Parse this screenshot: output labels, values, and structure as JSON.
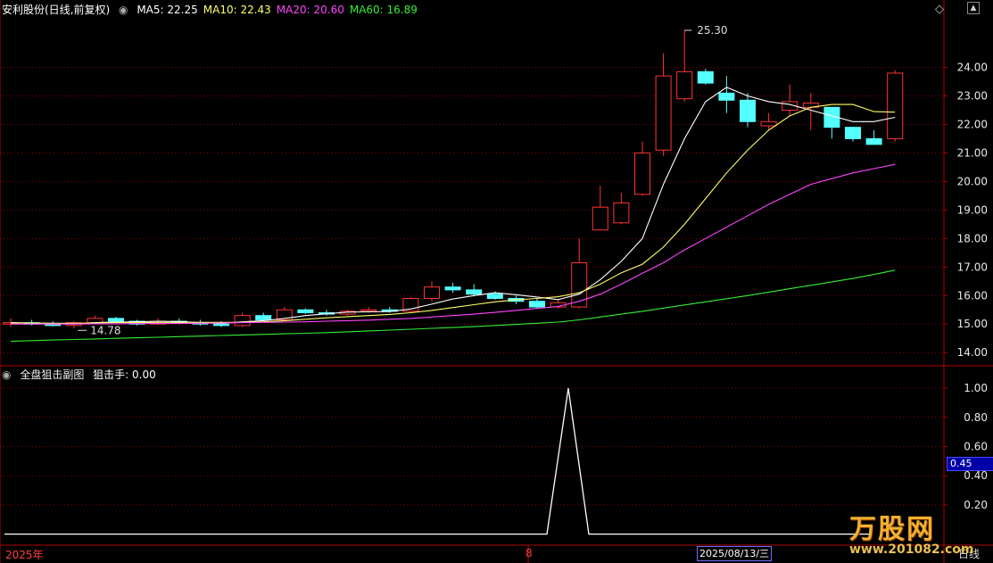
{
  "header": {
    "title": "安利股份(日线,前复权)",
    "ma_legend": [
      {
        "label": "MA5: 22.25",
        "color": "#ffffff"
      },
      {
        "label": "MA10: 22.43",
        "color": "#ffff66"
      },
      {
        "label": "MA20: 20.60",
        "color": "#ff44ff"
      },
      {
        "label": "MA60: 16.89",
        "color": "#33ee33"
      }
    ]
  },
  "sub_header": {
    "title": "全盘狙击副图",
    "indicator": "狙击手: 0.00"
  },
  "bottom": {
    "year_label": "2025年",
    "month_label": "8",
    "date_cursor": "2025/08/13/三",
    "period_label": "日线"
  },
  "value_box": "0.45",
  "brand": {
    "title": "万股网",
    "url": "www.201082.com"
  },
  "colors": {
    "up": "#ff3333",
    "down": "#54ffff",
    "ma5": "#ffffff",
    "ma10": "#ffff66",
    "ma20": "#ff44ff",
    "ma60": "#33ee33",
    "grid": "#8b0000",
    "axis": "#b00000"
  },
  "chart_data": [
    {
      "type": "candlestick",
      "title": "安利股份(日线,前复权)",
      "y_ticks": [
        "14.00",
        "15.00",
        "16.00",
        "17.00",
        "18.00",
        "19.00",
        "20.00",
        "21.00",
        "22.00",
        "23.00",
        "24.00"
      ],
      "ylim": [
        13.6,
        25.8
      ],
      "annotations": [
        {
          "text": "25.30",
          "value": 25.3
        },
        {
          "text": "14.78",
          "value": 14.78
        }
      ],
      "ohlc": [
        [
          15.0,
          15.2,
          14.9,
          15.05
        ],
        [
          15.05,
          15.15,
          14.95,
          15.0
        ],
        [
          15.0,
          15.1,
          14.92,
          14.95
        ],
        [
          14.95,
          15.1,
          14.85,
          15.05
        ],
        [
          15.05,
          15.3,
          15.0,
          15.2
        ],
        [
          15.2,
          15.25,
          15.05,
          15.1
        ],
        [
          15.1,
          15.15,
          14.95,
          15.0
        ],
        [
          15.0,
          15.2,
          14.98,
          15.1
        ],
        [
          15.1,
          15.2,
          15.0,
          15.05
        ],
        [
          15.05,
          15.15,
          14.95,
          15.0
        ],
        [
          15.0,
          15.1,
          14.9,
          14.95
        ],
        [
          14.95,
          15.4,
          14.9,
          15.3
        ],
        [
          15.3,
          15.4,
          15.1,
          15.15
        ],
        [
          15.15,
          15.6,
          15.1,
          15.5
        ],
        [
          15.5,
          15.55,
          15.35,
          15.4
        ],
        [
          15.4,
          15.5,
          15.3,
          15.35
        ],
        [
          15.35,
          15.5,
          15.3,
          15.45
        ],
        [
          15.45,
          15.6,
          15.4,
          15.5
        ],
        [
          15.5,
          15.6,
          15.4,
          15.45
        ],
        [
          15.45,
          15.95,
          15.4,
          15.9
        ],
        [
          15.9,
          16.5,
          15.8,
          16.3
        ],
        [
          16.3,
          16.45,
          16.1,
          16.2
        ],
        [
          16.2,
          16.4,
          16.0,
          16.05
        ],
        [
          16.05,
          16.15,
          15.85,
          15.9
        ],
        [
          15.9,
          16.0,
          15.7,
          15.8
        ],
        [
          15.8,
          15.9,
          15.55,
          15.6
        ],
        [
          15.6,
          15.85,
          15.55,
          15.75
        ],
        [
          15.6,
          18.0,
          15.55,
          17.15
        ],
        [
          18.3,
          19.85,
          18.3,
          19.1
        ],
        [
          18.55,
          19.6,
          18.5,
          19.25
        ],
        [
          19.55,
          21.4,
          19.5,
          21.0
        ],
        [
          21.1,
          24.5,
          20.9,
          23.7
        ],
        [
          22.9,
          25.3,
          22.8,
          23.85
        ],
        [
          23.85,
          23.95,
          23.4,
          23.45
        ],
        [
          23.1,
          23.7,
          22.4,
          22.85
        ],
        [
          22.85,
          23.1,
          21.9,
          22.1
        ],
        [
          21.95,
          22.4,
          21.8,
          22.1
        ],
        [
          22.5,
          23.4,
          22.3,
          22.8
        ],
        [
          22.6,
          23.1,
          21.8,
          22.75
        ],
        [
          22.6,
          22.6,
          21.5,
          21.9
        ],
        [
          21.9,
          21.9,
          21.4,
          21.5
        ],
        [
          21.5,
          21.8,
          21.3,
          21.3
        ],
        [
          21.5,
          23.9,
          21.4,
          23.8
        ]
      ],
      "series": [
        {
          "name": "MA5",
          "values": [
            15.05,
            15.04,
            15.02,
            15.0,
            15.05,
            15.07,
            15.08,
            15.1,
            15.09,
            15.05,
            15.02,
            15.08,
            15.12,
            15.2,
            15.3,
            15.36,
            15.42,
            15.43,
            15.44,
            15.53,
            15.7,
            15.88,
            16.0,
            16.1,
            16.03,
            15.95,
            15.86,
            16.05,
            16.56,
            17.2,
            18.0,
            19.9,
            21.5,
            22.8,
            23.3,
            23.0,
            22.8,
            22.7,
            22.5,
            22.3,
            22.1,
            22.1,
            22.25
          ]
        },
        {
          "name": "MA10",
          "values": [
            15.04,
            15.04,
            15.03,
            15.03,
            15.04,
            15.05,
            15.05,
            15.06,
            15.06,
            15.06,
            15.06,
            15.06,
            15.08,
            15.12,
            15.17,
            15.22,
            15.26,
            15.3,
            15.34,
            15.4,
            15.48,
            15.58,
            15.68,
            15.78,
            15.85,
            15.9,
            15.96,
            16.1,
            16.4,
            16.8,
            17.1,
            17.7,
            18.5,
            19.4,
            20.3,
            21.1,
            21.8,
            22.3,
            22.6,
            22.7,
            22.7,
            22.45,
            22.43
          ]
        },
        {
          "name": "MA20",
          "values": [
            15.0,
            15.0,
            15.0,
            15.0,
            15.01,
            15.01,
            15.02,
            15.02,
            15.02,
            15.03,
            15.04,
            15.05,
            15.06,
            15.07,
            15.08,
            15.1,
            15.12,
            15.14,
            15.17,
            15.2,
            15.25,
            15.3,
            15.35,
            15.41,
            15.48,
            15.55,
            15.62,
            15.8,
            16.05,
            16.4,
            16.78,
            17.15,
            17.6,
            18.0,
            18.4,
            18.8,
            19.2,
            19.55,
            19.9,
            20.1,
            20.3,
            20.45,
            20.6
          ]
        },
        {
          "name": "MA60",
          "values": [
            14.4,
            14.42,
            14.44,
            14.46,
            14.48,
            14.5,
            14.52,
            14.54,
            14.56,
            14.58,
            14.6,
            14.62,
            14.64,
            14.66,
            14.68,
            14.7,
            14.73,
            14.76,
            14.79,
            14.82,
            14.85,
            14.88,
            14.91,
            14.95,
            14.99,
            15.03,
            15.07,
            15.15,
            15.25,
            15.35,
            15.45,
            15.56,
            15.67,
            15.78,
            15.89,
            16.0,
            16.12,
            16.24,
            16.36,
            16.48,
            16.6,
            16.74,
            16.89
          ]
        }
      ]
    },
    {
      "type": "line",
      "title": "全盘狙击副图",
      "y_ticks": [
        "0.20",
        "0.40",
        "0.60",
        "0.80",
        "1.00"
      ],
      "ylim": [
        -0.07,
        1.08
      ],
      "series": [
        {
          "name": "狙击手",
          "values": [
            0,
            0,
            0,
            0,
            0,
            0,
            0,
            0,
            0,
            0,
            0,
            0,
            0,
            0,
            0,
            0,
            0,
            0,
            0,
            0,
            0,
            0,
            0,
            0,
            0,
            0,
            0,
            0,
            0,
            1,
            0,
            0,
            0,
            0,
            0,
            0,
            0,
            0,
            0,
            0,
            0,
            0,
            0
          ]
        }
      ]
    }
  ]
}
